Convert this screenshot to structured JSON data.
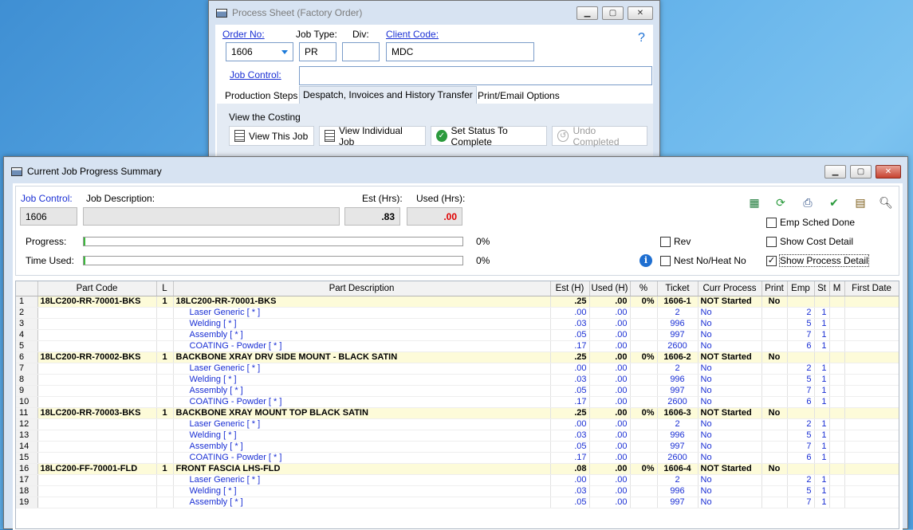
{
  "process_sheet": {
    "title": "Process Sheet (Factory Order)",
    "order_no_label": "Order No:",
    "order_no_value": "1606",
    "job_type_label": "Job Type:",
    "job_type_value": "PR",
    "div_label": "Div:",
    "div_value": "",
    "client_code_label": "Client Code:",
    "client_code_value": "MDC",
    "help_glyph": "?",
    "job_control_label": "Job Control:",
    "job_control_value": "",
    "tabs": [
      "Production Steps",
      "Despatch, Invoices and History Transfer",
      "Print/Email Options"
    ],
    "active_tab": 1,
    "section_title": "View the Costing",
    "buttons": {
      "view_this_job": "View This Job",
      "view_individual_job": "View Individual Job",
      "set_status_complete": "Set Status To Complete",
      "undo_completed": "Undo Completed"
    }
  },
  "progress": {
    "title": "Current Job Progress Summary",
    "job_control_label": "Job Control:",
    "job_control_value": "1606",
    "job_desc_label": "Job Description:",
    "job_desc_value": "",
    "est_label": "Est (Hrs):",
    "est_value": ".83",
    "used_label": "Used (Hrs):",
    "used_value": ".00",
    "progress_label": "Progress:",
    "progress_pct": "0%",
    "progress_fraction": 0,
    "time_used_label": "Time Used:",
    "time_used_pct": "0%",
    "time_used_fraction": 0,
    "checks": {
      "rev": {
        "label": "Rev",
        "checked": false
      },
      "nest": {
        "label": "Nest No/Heat No",
        "checked": false
      },
      "emp_sched": {
        "label": "Emp Sched Done",
        "checked": false
      },
      "cost_detail": {
        "label": "Show Cost Detail",
        "checked": false
      },
      "process_detail": {
        "label": "Show Process Detail",
        "checked": true
      }
    },
    "toolbar_icons": [
      "excel-export-icon",
      "refresh-icon",
      "print-icon",
      "complete-check-icon",
      "report-icon",
      "preview-icon"
    ],
    "colors": {
      "used_red": "#e00000",
      "row_highlight": "#fdfbd9",
      "link_blue": "#1a2fd4"
    }
  },
  "grid": {
    "columns": [
      "Part Code",
      "L",
      "Part Description",
      "Est (H)",
      "Used (H)",
      "%",
      "Ticket",
      "Curr Process",
      "Print",
      "Emp",
      "St",
      "M",
      "First Date"
    ],
    "rows": [
      {
        "n": "1",
        "type": "main",
        "code": "18LC200-RR-70001-BKS",
        "l": "1",
        "desc": "18LC200-RR-70001-BKS",
        "est": ".25",
        "used": ".00",
        "pct": "0%",
        "ticket": "1606-1",
        "proc": "NOT Started",
        "print": "No",
        "emp": "",
        "st": "",
        "m": "",
        "date": ""
      },
      {
        "n": "2",
        "type": "sub",
        "code": "",
        "l": "",
        "desc": "Laser Generic  [ * ]",
        "est": ".00",
        "used": ".00",
        "pct": "",
        "ticket": "2",
        "proc": "No",
        "print": "",
        "emp": "2",
        "st": "1",
        "m": "",
        "date": ""
      },
      {
        "n": "3",
        "type": "sub",
        "code": "",
        "l": "",
        "desc": "Welding  [ * ]",
        "est": ".03",
        "used": ".00",
        "pct": "",
        "ticket": "996",
        "proc": "No",
        "print": "",
        "emp": "5",
        "st": "1",
        "m": "",
        "date": ""
      },
      {
        "n": "4",
        "type": "sub",
        "code": "",
        "l": "",
        "desc": "Assembly  [ * ]",
        "est": ".05",
        "used": ".00",
        "pct": "",
        "ticket": "997",
        "proc": "No",
        "print": "",
        "emp": "7",
        "st": "1",
        "m": "",
        "date": ""
      },
      {
        "n": "5",
        "type": "sub",
        "code": "",
        "l": "",
        "desc": "COATING - Powder  [ * ]",
        "est": ".17",
        "used": ".00",
        "pct": "",
        "ticket": "2600",
        "proc": "No",
        "print": "",
        "emp": "6",
        "st": "1",
        "m": "",
        "date": ""
      },
      {
        "n": "6",
        "type": "main",
        "code": "18LC200-RR-70002-BKS",
        "l": "1",
        "desc": "BACKBONE XRAY DRV SIDE MOUNT - BLACK SATIN",
        "est": ".25",
        "used": ".00",
        "pct": "0%",
        "ticket": "1606-2",
        "proc": "NOT Started",
        "print": "No",
        "emp": "",
        "st": "",
        "m": "",
        "date": ""
      },
      {
        "n": "7",
        "type": "sub",
        "code": "",
        "l": "",
        "desc": "Laser Generic  [ * ]",
        "est": ".00",
        "used": ".00",
        "pct": "",
        "ticket": "2",
        "proc": "No",
        "print": "",
        "emp": "2",
        "st": "1",
        "m": "",
        "date": ""
      },
      {
        "n": "8",
        "type": "sub",
        "code": "",
        "l": "",
        "desc": "Welding  [ * ]",
        "est": ".03",
        "used": ".00",
        "pct": "",
        "ticket": "996",
        "proc": "No",
        "print": "",
        "emp": "5",
        "st": "1",
        "m": "",
        "date": ""
      },
      {
        "n": "9",
        "type": "sub",
        "code": "",
        "l": "",
        "desc": "Assembly  [ * ]",
        "est": ".05",
        "used": ".00",
        "pct": "",
        "ticket": "997",
        "proc": "No",
        "print": "",
        "emp": "7",
        "st": "1",
        "m": "",
        "date": ""
      },
      {
        "n": "10",
        "type": "sub",
        "code": "",
        "l": "",
        "desc": "COATING - Powder  [ * ]",
        "est": ".17",
        "used": ".00",
        "pct": "",
        "ticket": "2600",
        "proc": "No",
        "print": "",
        "emp": "6",
        "st": "1",
        "m": "",
        "date": ""
      },
      {
        "n": "11",
        "type": "main",
        "code": "18LC200-RR-70003-BKS",
        "l": "1",
        "desc": "BACKBONE XRAY MOUNT TOP BLACK SATIN",
        "est": ".25",
        "used": ".00",
        "pct": "0%",
        "ticket": "1606-3",
        "proc": "NOT Started",
        "print": "No",
        "emp": "",
        "st": "",
        "m": "",
        "date": ""
      },
      {
        "n": "12",
        "type": "sub",
        "code": "",
        "l": "",
        "desc": "Laser Generic  [ * ]",
        "est": ".00",
        "used": ".00",
        "pct": "",
        "ticket": "2",
        "proc": "No",
        "print": "",
        "emp": "2",
        "st": "1",
        "m": "",
        "date": ""
      },
      {
        "n": "13",
        "type": "sub",
        "code": "",
        "l": "",
        "desc": "Welding  [ * ]",
        "est": ".03",
        "used": ".00",
        "pct": "",
        "ticket": "996",
        "proc": "No",
        "print": "",
        "emp": "5",
        "st": "1",
        "m": "",
        "date": ""
      },
      {
        "n": "14",
        "type": "sub",
        "code": "",
        "l": "",
        "desc": "Assembly  [ * ]",
        "est": ".05",
        "used": ".00",
        "pct": "",
        "ticket": "997",
        "proc": "No",
        "print": "",
        "emp": "7",
        "st": "1",
        "m": "",
        "date": ""
      },
      {
        "n": "15",
        "type": "sub",
        "code": "",
        "l": "",
        "desc": "COATING - Powder  [ * ]",
        "est": ".17",
        "used": ".00",
        "pct": "",
        "ticket": "2600",
        "proc": "No",
        "print": "",
        "emp": "6",
        "st": "1",
        "m": "",
        "date": ""
      },
      {
        "n": "16",
        "type": "main",
        "code": "18LC200-FF-70001-FLD",
        "l": "1",
        "desc": "FRONT FASCIA LHS-FLD",
        "est": ".08",
        "used": ".00",
        "pct": "0%",
        "ticket": "1606-4",
        "proc": "NOT Started",
        "print": "No",
        "emp": "",
        "st": "",
        "m": "",
        "date": ""
      },
      {
        "n": "17",
        "type": "sub",
        "code": "",
        "l": "",
        "desc": "Laser Generic  [ * ]",
        "est": ".00",
        "used": ".00",
        "pct": "",
        "ticket": "2",
        "proc": "No",
        "print": "",
        "emp": "2",
        "st": "1",
        "m": "",
        "date": ""
      },
      {
        "n": "18",
        "type": "sub",
        "code": "",
        "l": "",
        "desc": "Welding  [ * ]",
        "est": ".03",
        "used": ".00",
        "pct": "",
        "ticket": "996",
        "proc": "No",
        "print": "",
        "emp": "5",
        "st": "1",
        "m": "",
        "date": ""
      },
      {
        "n": "19",
        "type": "sub",
        "code": "",
        "l": "",
        "desc": "Assembly  [ * ]",
        "est": ".05",
        "used": ".00",
        "pct": "",
        "ticket": "997",
        "proc": "No",
        "print": "",
        "emp": "7",
        "st": "1",
        "m": "",
        "date": ""
      }
    ]
  }
}
